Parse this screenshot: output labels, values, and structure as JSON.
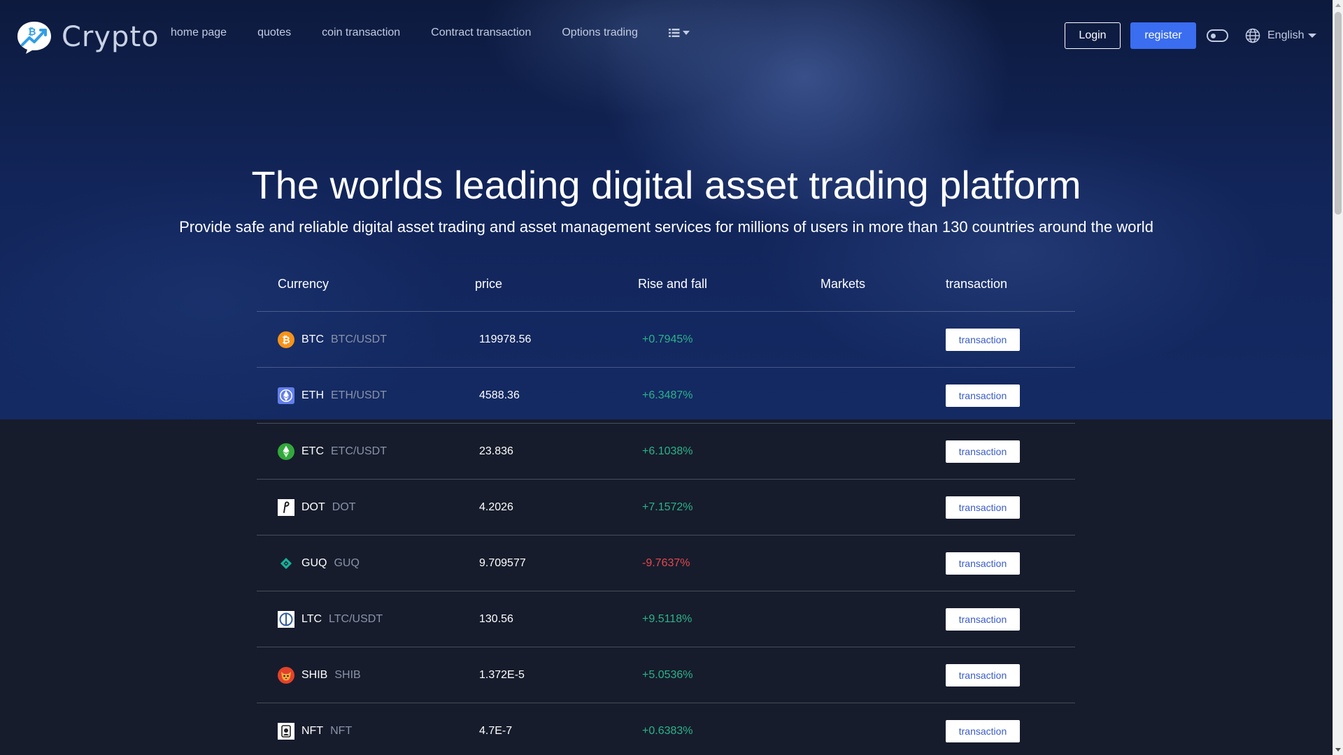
{
  "brand": {
    "name": "Crypto"
  },
  "nav": {
    "items": [
      "home page",
      "quotes",
      "coin transaction",
      "Contract transaction",
      "Options trading"
    ],
    "more_icon": "list-icon"
  },
  "auth": {
    "login_label": "Login",
    "register_label": "register"
  },
  "language": {
    "selected": "English"
  },
  "hero": {
    "title": "The worlds leading digital asset trading platform",
    "subtitle": "Provide safe and reliable digital asset trading and asset management services for millions of users in more than 130 countries around the world"
  },
  "table": {
    "headers": {
      "currency": "Currency",
      "price": "price",
      "change": "Rise and fall",
      "markets": "Markets",
      "transaction": "transaction"
    },
    "rows": [
      {
        "symbol": "BTC",
        "pair": "BTC/USDT",
        "price": "119978.56",
        "change": "+0.7945%",
        "trend": "up",
        "button": "transaction",
        "icon": "btc-icon"
      },
      {
        "symbol": "ETH",
        "pair": "ETH/USDT",
        "price": "4588.36",
        "change": "+6.3487%",
        "trend": "up",
        "button": "transaction",
        "icon": "eth-icon"
      },
      {
        "symbol": "ETC",
        "pair": "ETC/USDT",
        "price": "23.836",
        "change": "+6.1038%",
        "trend": "up",
        "button": "transaction",
        "icon": "etc-icon"
      },
      {
        "symbol": "DOT",
        "pair": "DOT",
        "price": "4.2026",
        "change": "+7.1572%",
        "trend": "up",
        "button": "transaction",
        "icon": "dot-icon"
      },
      {
        "symbol": "GUQ",
        "pair": "GUQ",
        "price": "9.709577",
        "change": "-9.7637%",
        "trend": "down",
        "button": "transaction",
        "icon": "guq-icon"
      },
      {
        "symbol": "LTC",
        "pair": "LTC/USDT",
        "price": "130.56",
        "change": "+9.5118%",
        "trend": "up",
        "button": "transaction",
        "icon": "ltc-icon"
      },
      {
        "symbol": "SHIB",
        "pair": "SHIB",
        "price": "1.372E-5",
        "change": "+5.0536%",
        "trend": "up",
        "button": "transaction",
        "icon": "shib-icon"
      },
      {
        "symbol": "NFT",
        "pair": "NFT",
        "price": "4.7E-7",
        "change": "+0.6383%",
        "trend": "up",
        "button": "transaction",
        "icon": "nft-icon"
      }
    ]
  },
  "colors": {
    "accent": "#3a6df0",
    "up": "#2bb38a",
    "down": "#e5484d",
    "background": "#161c2c"
  }
}
